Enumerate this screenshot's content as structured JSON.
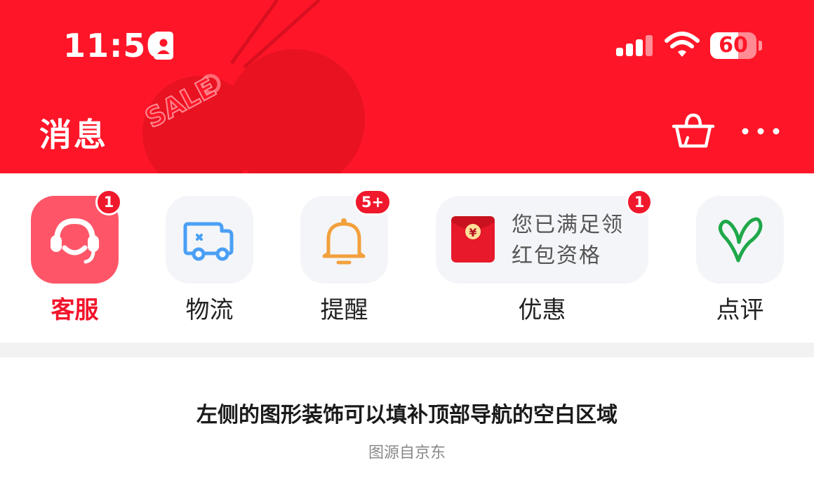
{
  "status_bar": {
    "time": "11:50",
    "battery_text": "60",
    "battery_level": 0.6
  },
  "header": {
    "title": "消息",
    "deco_text": "SALE",
    "icons": [
      "cart-icon",
      "more-icon"
    ]
  },
  "categories": [
    {
      "label": "客服",
      "icon": "customer-service-icon",
      "badge": "1",
      "active": true
    },
    {
      "label": "物流",
      "icon": "delivery-truck-icon",
      "badge": ""
    },
    {
      "label": "提醒",
      "icon": "bell-icon",
      "badge": "5+"
    },
    {
      "label": "优惠",
      "icon": "red-packet-icon",
      "badge": "1",
      "promo_text": "您已满足领红包资格",
      "promo_symbol": "¥"
    },
    {
      "label": "点评",
      "icon": "heart-leaf-icon",
      "badge": ""
    }
  ],
  "caption": "左侧的图形装饰可以填补顶部导航的空白区域",
  "source": "图源自京东",
  "colors": {
    "brand_red": "#fe1628",
    "active_tile": "#fe5668",
    "badge_red": "#f0182c",
    "truck_blue": "#4a9ff5",
    "bell_orange": "#f2a03d",
    "leaf_green": "#1fa84a"
  }
}
